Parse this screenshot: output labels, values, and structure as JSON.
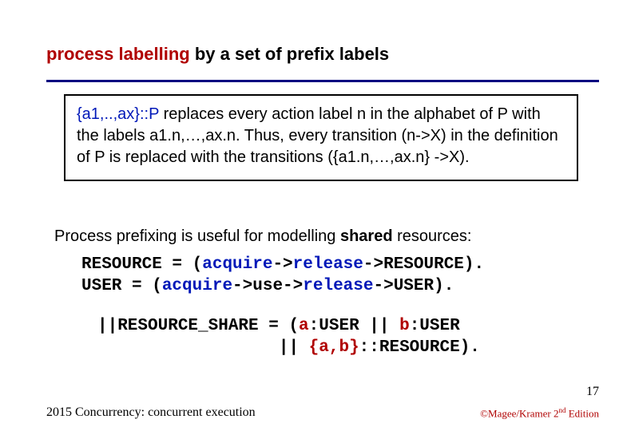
{
  "title": {
    "pre": "process labelling",
    "rest": " by a set of prefix labels"
  },
  "def": {
    "formula": "{a1,..,ax}::P",
    "rest": " replaces every action label n in the alphabet of P with the labels a1.n,…,ax.n. Thus, every transition (n->X) in the definition of P is replaced with the transitions ({a1.n,…,ax.n} ->X)."
  },
  "useful": {
    "t1": "Process prefixing is useful for modelling ",
    "shared": "shared",
    "t2": " resources:"
  },
  "code1": {
    "l1a": "RESOURCE = (",
    "l1b": "acquire",
    "l1c": "->",
    "l1d": "release",
    "l1e": "->RESOURCE).",
    "l2a": "USER = (",
    "l2b": "acquire",
    "l2c": "->use->",
    "l2d": "release",
    "l2e": "->USER)."
  },
  "code2": {
    "l1a": "||RESOURCE_SHARE = (",
    "l1b": "a",
    "l1c": ":USER || ",
    "l1d": "b",
    "l1e": ":USER",
    "l2a": "                  || ",
    "l2b": "{a,b}",
    "l2c": "::RESOURCE)."
  },
  "pagenum": "17",
  "footer": {
    "left": "2015  Concurrency: concurrent execution",
    "r1": "©Magee/Kramer ",
    "r2": "2",
    "r3": "nd",
    "r4": " Edition"
  }
}
